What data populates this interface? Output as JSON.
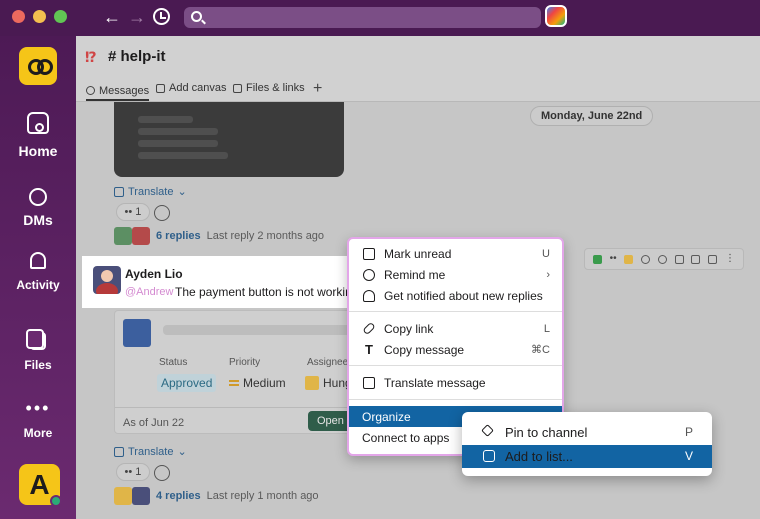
{
  "window": {
    "accent_purple": "#4a154b",
    "search_placeholder": ""
  },
  "sidebar": {
    "items": [
      {
        "label": "Home",
        "icon": "home-icon"
      },
      {
        "label": "DMs",
        "icon": "dm-icon"
      },
      {
        "label": "Activity",
        "icon": "bell-icon"
      },
      {
        "label": "Files",
        "icon": "files-icon"
      },
      {
        "label": "More",
        "icon": "more-icon"
      }
    ],
    "user_initial": "A"
  },
  "channel": {
    "emoji": "⁉",
    "name": "# help-it",
    "tabs": [
      {
        "label": "Messages",
        "icon": "message-icon"
      },
      {
        "label": "Add canvas",
        "icon": "canvas-icon"
      },
      {
        "label": "Files & links",
        "icon": "files-links-icon"
      }
    ],
    "add_tab": "+"
  },
  "feed": {
    "date_divider": "Monday, June 22nd",
    "translate_label": "Translate",
    "thread1": {
      "reaction": "•• 1",
      "replies": "6 replies",
      "last_reply": "Last reply 2 months ago"
    },
    "message": {
      "author": "Ayden Lio",
      "mention": "@Andrew",
      "text": "The payment button is not working."
    },
    "workflow": {
      "status_label": "Status",
      "status_value": "Approved",
      "priority_label": "Priority",
      "priority_value": "Medium",
      "assignee_label": "Assignee",
      "assignee_value": "Hung",
      "date": "As of Jun 22",
      "open_button": "Open i"
    },
    "thread2": {
      "reaction": "•• 1",
      "replies": "4 replies",
      "last_reply": "Last reply 1 month ago"
    }
  },
  "context_menu": {
    "items": [
      {
        "label": "Mark unread",
        "shortcut": "U",
        "icon": "mark-unread-icon"
      },
      {
        "label": "Remind me",
        "shortcut": "›",
        "icon": "clock-icon"
      },
      {
        "label": "Get notified about new replies",
        "shortcut": "",
        "icon": "bell-icon"
      },
      {
        "label": "Copy link",
        "shortcut": "L",
        "icon": "link-icon"
      },
      {
        "label": "Copy message",
        "shortcut": "⌘C",
        "icon": "text-icon"
      },
      {
        "label": "Translate message",
        "shortcut": "",
        "icon": "translate-icon"
      },
      {
        "label": "Organize",
        "shortcut": "",
        "icon": ""
      },
      {
        "label": "Connect to apps",
        "shortcut": "",
        "icon": ""
      }
    ],
    "selected": "Organize",
    "selected_color": "#1264a3"
  },
  "submenu": {
    "items": [
      {
        "label": "Pin to channel",
        "shortcut": "P",
        "icon": "pin-icon"
      },
      {
        "label": "Add to list...",
        "shortcut": "V",
        "icon": "list-icon"
      }
    ],
    "selected": "Add to list..."
  }
}
